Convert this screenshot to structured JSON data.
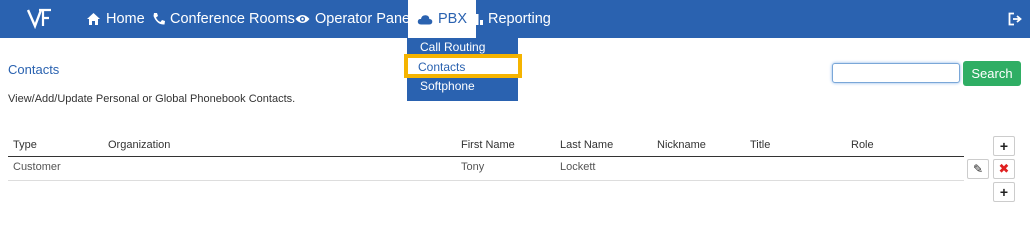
{
  "nav": {
    "home": "Home",
    "conference_rooms": "Conference Rooms",
    "operator_panel": "Operator Panel",
    "pbx": "PBX",
    "reporting": "Reporting"
  },
  "pbx_menu": {
    "items": [
      "Call Routing",
      "Contacts",
      "Softphone"
    ],
    "highlighted": "Contacts"
  },
  "page": {
    "title": "Contacts",
    "subtitle": "View/Add/Update Personal or Global Phonebook Contacts."
  },
  "search": {
    "value": "",
    "button_label": "Search"
  },
  "table": {
    "columns": [
      "Type",
      "Organization",
      "First Name",
      "Last Name",
      "Nickname",
      "Title",
      "Role"
    ],
    "rows": [
      {
        "type": "Customer",
        "organization": "",
        "first_name": "Tony",
        "last_name": "Lockett",
        "nickname": "",
        "title": "",
        "role": ""
      }
    ]
  },
  "buttons": {
    "add": "+",
    "delete": "✖",
    "edit": "✎"
  },
  "colors": {
    "nav_bg": "#2a62b0",
    "highlight": "#f5b400",
    "search_btn": "#2fae64",
    "delete": "#e02020"
  }
}
